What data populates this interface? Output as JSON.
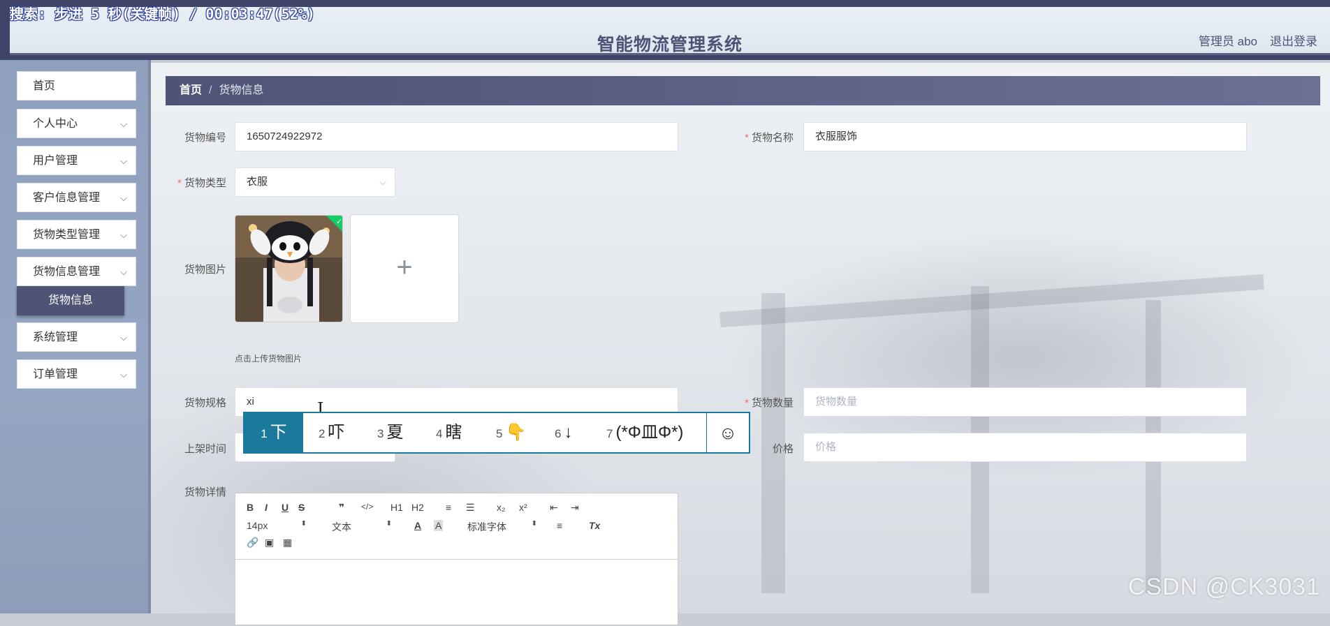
{
  "overlay": "搜索: 步进 5 秒(关键帧) / 00:03:47(52%)",
  "header": {
    "title": "智能物流管理系统",
    "user": "管理员 abo",
    "logout": "退出登录"
  },
  "sidebar": {
    "items": [
      {
        "label": "首页"
      },
      {
        "label": "个人中心"
      },
      {
        "label": "用户管理"
      },
      {
        "label": "客户信息管理"
      },
      {
        "label": "货物类型管理"
      },
      {
        "label": "货物信息管理"
      },
      {
        "label": "系统管理"
      },
      {
        "label": "订单管理"
      }
    ],
    "sub_active": "货物信息"
  },
  "breadcrumb": {
    "home": "首页",
    "sep": "/",
    "current": "货物信息"
  },
  "form": {
    "code_label": "货物编号",
    "code_value": "1650724922972",
    "name_label": "货物名称",
    "name_value": "衣服服饰",
    "type_label": "货物类型",
    "type_value": "衣服",
    "image_label": "货物图片",
    "image_hint": "点击上传货物图片",
    "spec_label": "货物规格",
    "spec_value": "xi",
    "qty_label": "货物数量",
    "qty_placeholder": "货物数量",
    "shelf_label": "上架时间",
    "price_label": "价格",
    "price_placeholder": "价格",
    "detail_label": "货物详情",
    "required_mark": "*"
  },
  "ime": {
    "candidates": [
      {
        "n": "1",
        "text": "下"
      },
      {
        "n": "2",
        "text": "吓"
      },
      {
        "n": "3",
        "text": "夏"
      },
      {
        "n": "4",
        "text": "瞎"
      },
      {
        "n": "5",
        "text": "👇"
      },
      {
        "n": "6",
        "text": "↓"
      },
      {
        "n": "7",
        "text": "(*Φ皿Φ*)"
      }
    ],
    "emoji": "☺"
  },
  "editor": {
    "font_size": "14px",
    "text_style": "文本",
    "font_family": "标准字体",
    "tools_row1": [
      "B",
      "I",
      "U",
      "S",
      "❞",
      "</>",
      "H1",
      "H2",
      "≡",
      "☰",
      "x₂",
      "x²",
      "⇤",
      "⇥"
    ],
    "tools_row3": [
      "🔗",
      "▣",
      "▦"
    ],
    "color_a": "A",
    "bg_a": "A",
    "clear": "Tx"
  },
  "watermark": "CSDN @CK3031"
}
